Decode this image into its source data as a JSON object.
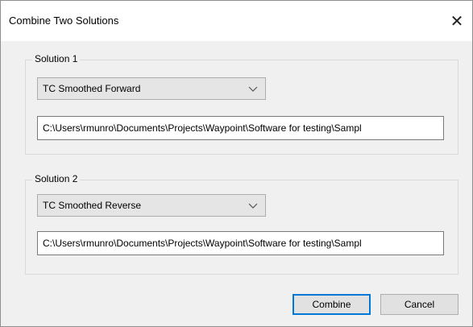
{
  "window": {
    "title": "Combine Two Solutions",
    "close_glyph": "✕"
  },
  "solution1": {
    "label": "Solution 1",
    "selected": "TC Smoothed Forward",
    "path": "C:\\Users\\rmunro\\Documents\\Projects\\Waypoint\\Software for testing\\Sampl"
  },
  "solution2": {
    "label": "Solution 2",
    "selected": "TC Smoothed Reverse",
    "path": "C:\\Users\\rmunro\\Documents\\Projects\\Waypoint\\Software for testing\\Sampl"
  },
  "buttons": {
    "combine": "Combine",
    "cancel": "Cancel"
  },
  "colors": {
    "accent": "#0078d7",
    "panel": "#f0f0f0",
    "button": "#e1e1e1"
  },
  "icons": {
    "close": "close-icon",
    "dropdown": "chevron-down-icon"
  }
}
